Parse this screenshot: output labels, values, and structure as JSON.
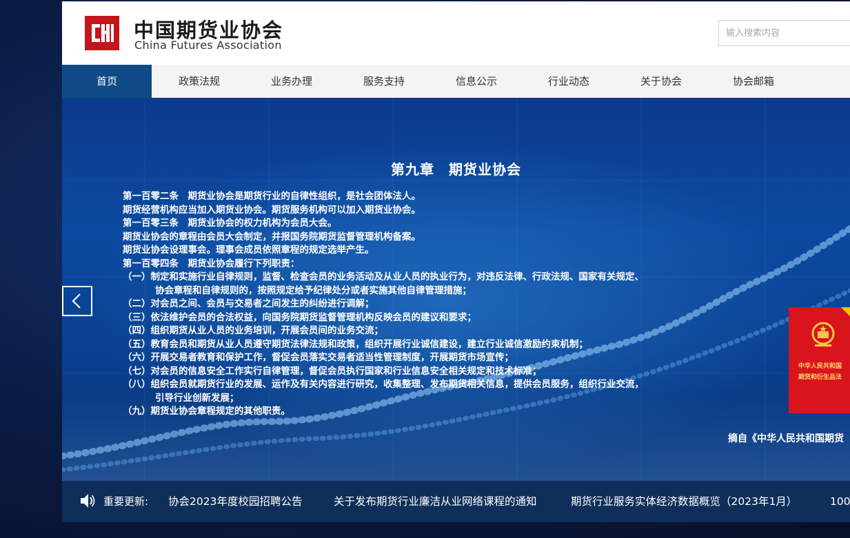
{
  "header": {
    "logo_cn": "中国期货业协会",
    "logo_en": "China Futures Association",
    "search_placeholder": "输入搜索内容"
  },
  "nav": {
    "items": [
      "首页",
      "政策法规",
      "业务办理",
      "服务支持",
      "信息公示",
      "行业动态",
      "关于协会",
      "协会邮箱"
    ],
    "active_index": 0
  },
  "banner": {
    "title": "第九章　期货业协会",
    "lines": [
      "第一百零二条　期货业协会是期货行业的自律性组织，是社会团体法人。",
      "期货经营机构应当加入期货业协会。期货服务机构可以加入期货业协会。",
      "第一百零三条　期货业协会的权力机构为会员大会。",
      "期货业协会的章程由会员大会制定，并报国务院期货监督管理机构备案。",
      "期货业协会设理事会。理事会成员依照章程的规定选举产生。",
      "第一百零四条　期货业协会履行下列职责：",
      "（一）制定和实施行业自律规则，监督、检查会员的业务活动及从业人员的执业行为，对违反法律、行政法规、国家有关规定、",
      "协会章程和自律规则的，按照规定给予纪律处分或者实施其他自律管理措施；",
      "（二）对会员之间、会员与交易者之间发生的纠纷进行调解；",
      "（三）依法维护会员的合法权益，向国务院期货监督管理机构反映会员的建议和要求；",
      "（四）组织期货从业人员的业务培训，开展会员间的业务交流；",
      "（五）教育会员和期货从业人员遵守期货法律法规和政策，组织开展行业诚信建设，建立行业诚信激励约束机制；",
      "（六）开展交易者教育和保护工作，督促会员落实交易者适当性管理制度，开展期货市场宣传；",
      "（七）对会员的信息安全工作实行自律管理，督促会员执行国家和行业信息安全相关规定和技术标准；",
      "（八）组织会员就期货行业的发展、运作及有关内容进行研究，收集整理、发布期货相关信息，提供会员服务，组织行业交流，",
      "引导行业创新发展；",
      "（九）期货业协会章程规定的其他职责。"
    ],
    "source": "摘自《中华人民共和国期货",
    "book_title_1": "中华人民共和国",
    "book_title_2": "期货和衍生品法"
  },
  "notice": {
    "label": "重要更新:",
    "items": [
      "协会2023年度校园招聘公告",
      "关于发布期货行业廉洁从业网络课程的通知",
      "期货行业服务实体经济数据概览（2023年1月）",
      "100"
    ]
  },
  "colors": {
    "nav_active": "#0f4b86",
    "logo_red": "#c4151c",
    "notice_bg": "#0f2f5a",
    "banner_blue": "#0b4aa0"
  }
}
